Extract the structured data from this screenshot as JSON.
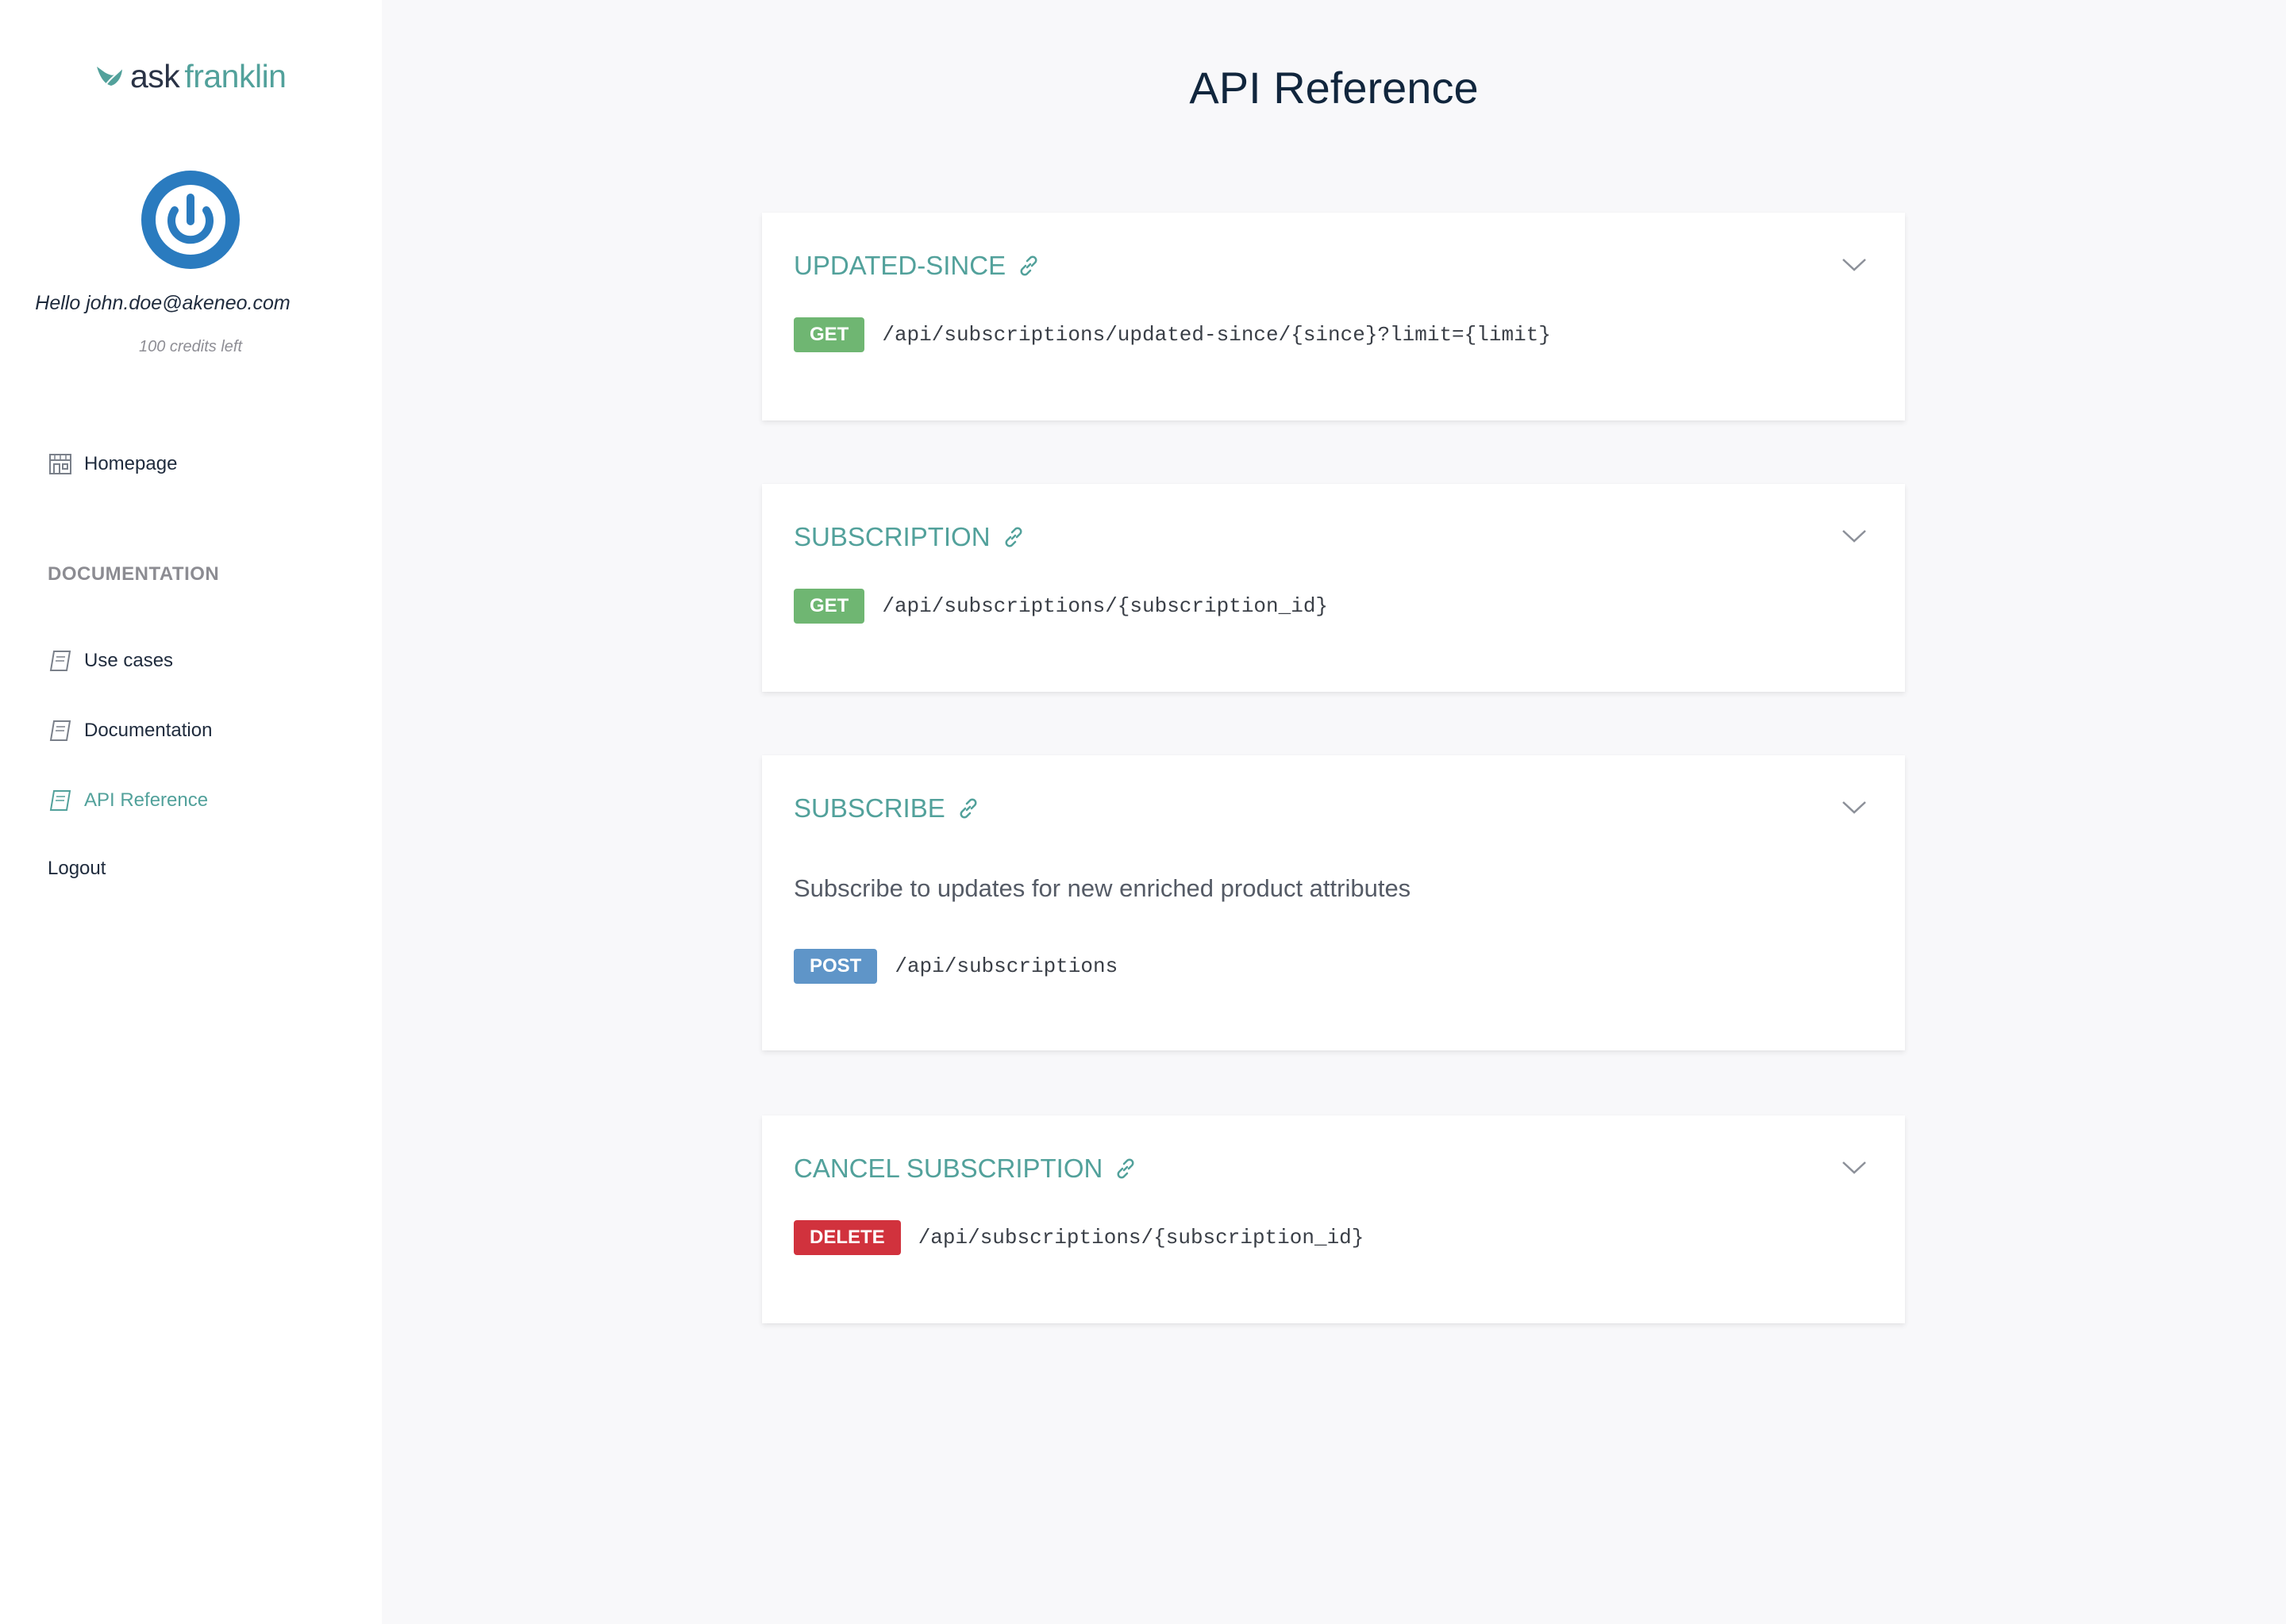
{
  "sidebar": {
    "logo": {
      "part1": "ask",
      "part2": "franklin"
    },
    "greeting": "Hello john.doe@akeneo.com",
    "credits": "100 credits left",
    "nav": {
      "homepage": "Homepage",
      "section_title": "DOCUMENTATION",
      "use_cases": "Use cases",
      "documentation": "Documentation",
      "api_reference": "API Reference",
      "logout": "Logout"
    },
    "active_item": "API Reference"
  },
  "main": {
    "title": "API Reference",
    "endpoints": [
      {
        "title": "UPDATED-SINCE",
        "method": "GET",
        "path": "/api/subscriptions/updated-since/{since}?limit={limit}",
        "description": ""
      },
      {
        "title": "SUBSCRIPTION",
        "method": "GET",
        "path": "/api/subscriptions/{subscription_id}",
        "description": ""
      },
      {
        "title": "SUBSCRIBE",
        "method": "POST",
        "path": "/api/subscriptions",
        "description": "Subscribe to updates for new enriched product attributes"
      },
      {
        "title": "CANCEL SUBSCRIPTION",
        "method": "DELETE",
        "path": "/api/subscriptions/{subscription_id}",
        "description": ""
      }
    ]
  },
  "colors": {
    "accent": "#52a19b",
    "get": "#6fb672",
    "post": "#5f95c8",
    "delete": "#d1323d",
    "avatar": "#2a7bbf"
  },
  "icons": {
    "logo": "leaf-icon",
    "avatar": "power-icon",
    "homepage": "store-icon",
    "docs": "book-icon",
    "link": "link-icon",
    "expand": "chevron-down-icon"
  }
}
